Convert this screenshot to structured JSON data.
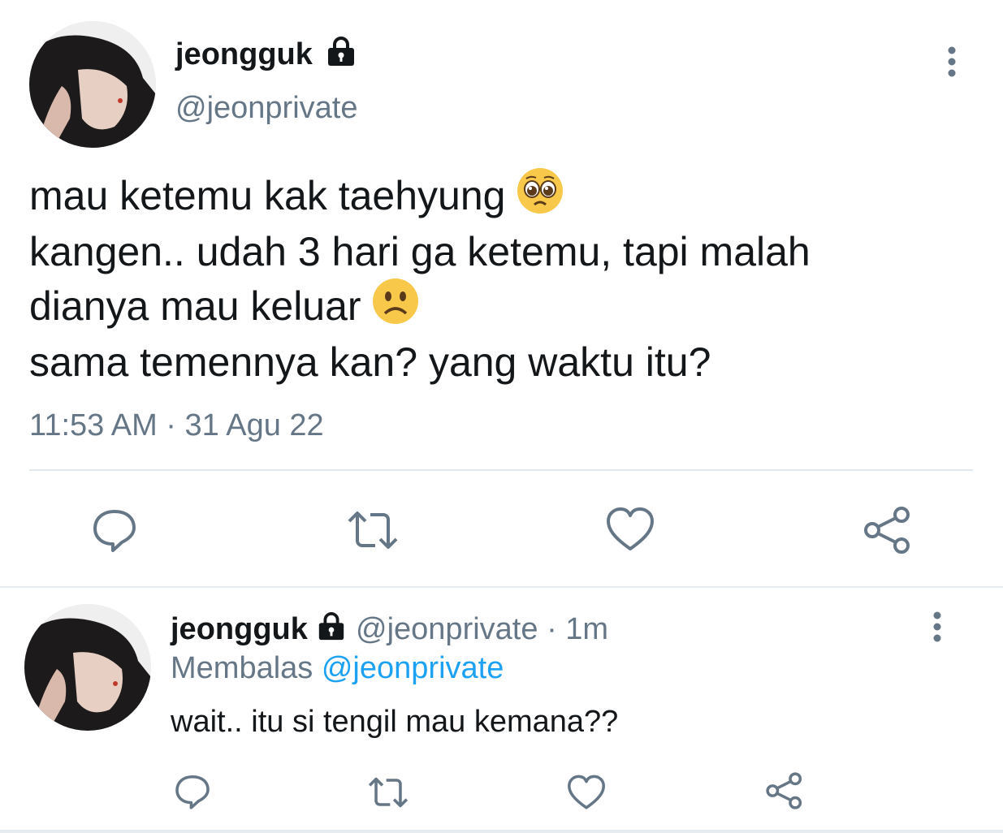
{
  "main_tweet": {
    "display_name": "jeongguk",
    "handle": "@jeonprivate",
    "lines": [
      "mau ketemu kak taehyung",
      "kangen.. udah 3 hari ga ketemu, tapi malah",
      "dianya mau keluar",
      "sama temennya kan? yang waktu itu?"
    ],
    "timestamp": "11:53 AM · 31 Agu 22",
    "icons": [
      "reply-icon",
      "retweet-icon",
      "like-icon",
      "share-icon"
    ]
  },
  "reply_tweet": {
    "display_name": "jeongguk",
    "handle": "@jeonprivate",
    "age": "· 1m",
    "replying_label": "Membalas",
    "replying_to": "@jeonprivate",
    "text": "wait.. itu si tengil mau kemana??",
    "icons": [
      "reply-icon",
      "retweet-icon",
      "like-icon",
      "share-icon"
    ]
  },
  "colors": {
    "text": "#14171a",
    "muted": "#657786",
    "link": "#1da1f2",
    "divider": "#e1e8ed"
  }
}
